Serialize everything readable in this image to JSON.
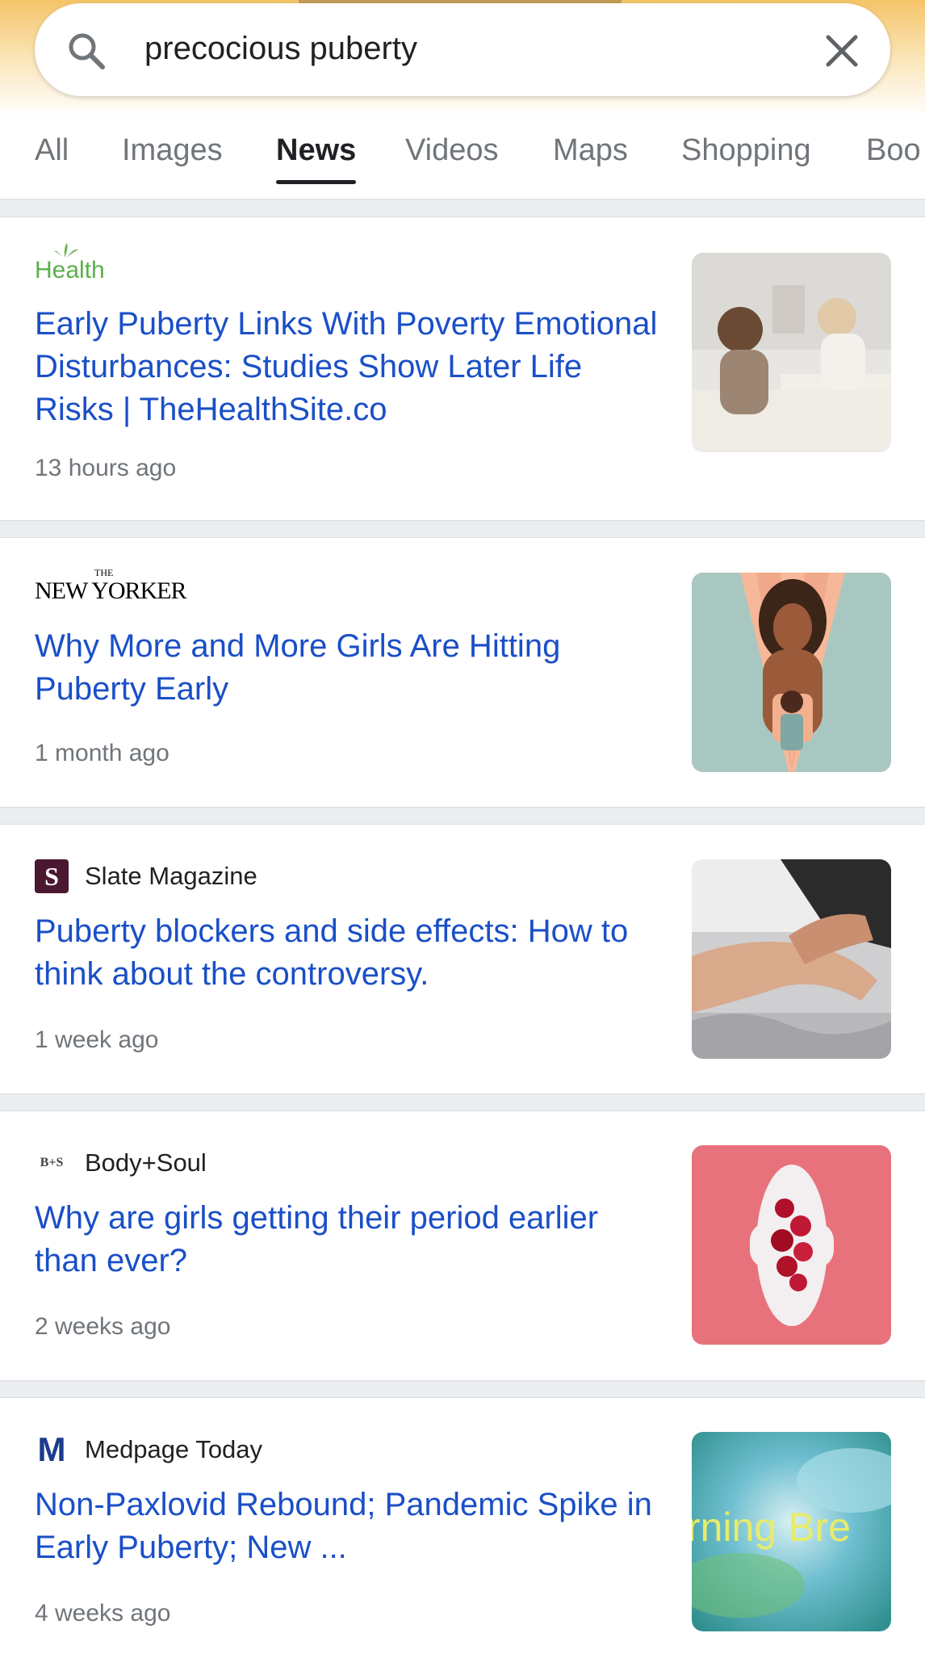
{
  "search": {
    "query": "precocious puberty",
    "placeholder": "Search"
  },
  "tabs": [
    {
      "label": "All"
    },
    {
      "label": "Images"
    },
    {
      "label": "News",
      "active": true
    },
    {
      "label": "Videos"
    },
    {
      "label": "Maps"
    },
    {
      "label": "Shopping"
    },
    {
      "label": "Boo"
    }
  ],
  "articles": [
    {
      "source": "Health",
      "logo_text": "Health",
      "headline": "Early Puberty Links With Poverty Emotional Disturbances: Studies Show Later Life Risks | TheHealthSite.co",
      "time": "13 hours ago"
    },
    {
      "source": "NEW YORKER",
      "logo_text_small": "THE",
      "logo_text": "NEW YORKER",
      "headline": "Why More and More Girls Are Hitting Puberty Early",
      "time": "1 month ago"
    },
    {
      "source": "Slate Magazine",
      "logo_text": "S",
      "headline": "Puberty blockers and side effects: How to think about the controversy.",
      "time": "1 week ago"
    },
    {
      "source": "Body+Soul",
      "logo_text": "B+S",
      "headline": "Why are girls getting their period earlier than ever?",
      "time": "2 weeks ago"
    },
    {
      "source": "Medpage Today",
      "logo_text": "M",
      "headline": "Non-Paxlovid Rebound; Pandemic Spike in Early Puberty; New ...",
      "time": "4 weeks ago",
      "thumb_text": "rning Bre"
    }
  ],
  "colors": {
    "link": "#1a4fc7",
    "meta": "#70757a",
    "text": "#202124",
    "header_gradient": "#f5c468",
    "separator": "#ebeef1"
  },
  "icons": {
    "search": "search-icon",
    "clear": "close-icon"
  }
}
